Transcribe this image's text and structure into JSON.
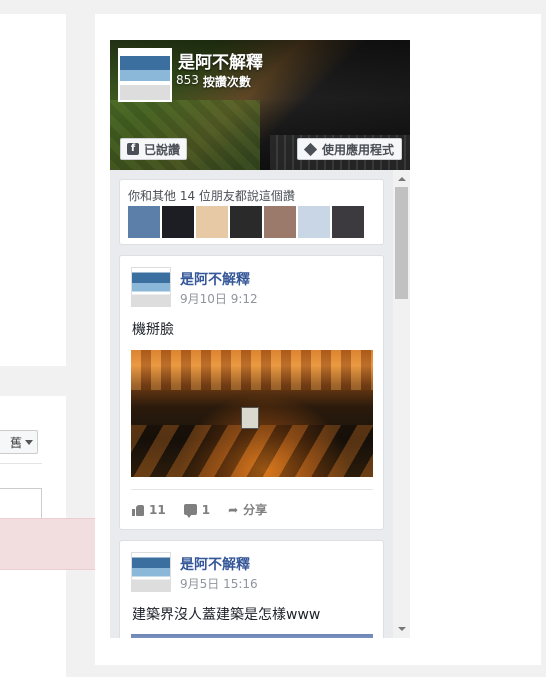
{
  "left_panel": {
    "sort_label": "舊",
    "toast_close": "×"
  },
  "plugin": {
    "page_name": "是阿不解釋",
    "like_count": "853",
    "like_count_label": "按讚次數",
    "liked_button": "已說讚",
    "app_button": "使用應用程式",
    "friends_text": "你和其他 14 位朋友都說這個讚",
    "friend_faces": [
      {
        "bg": "#5b7fa8"
      },
      {
        "bg": "#1d1d24"
      },
      {
        "bg": "#e8c9a6"
      },
      {
        "bg": "#2a2a2a"
      },
      {
        "bg": "#9c7a6b"
      },
      {
        "bg": "#c8d6e5"
      },
      {
        "bg": "#3d3a3f"
      }
    ]
  },
  "posts": [
    {
      "author": "是阿不解釋",
      "date": "9月10日 9:12",
      "text": "機掰臉",
      "likes": "11",
      "comments": "1",
      "share_label": "分享"
    },
    {
      "author": "是阿不解釋",
      "date": "9月5日 15:16",
      "text": "建築界沒人蓋建築是怎樣www"
    }
  ],
  "colors": {
    "fb_blue": "#365899",
    "toast_bg": "#f2dede"
  }
}
